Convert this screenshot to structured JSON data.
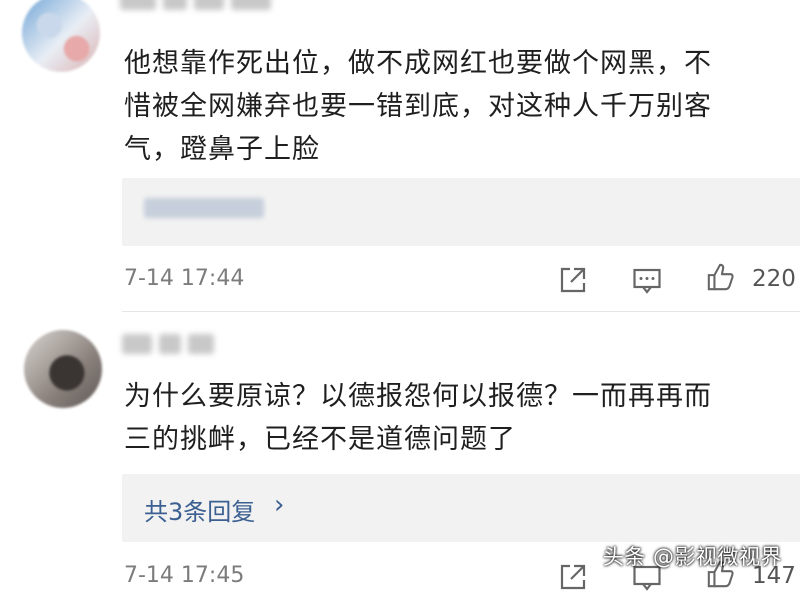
{
  "comments": [
    {
      "text_lines": [
        "他想靠作死出位，做不成网红也要做个网黑，不",
        "惜被全网嫌弃也要一错到底，对这种人千万别客",
        "气，蹬鼻子上脸"
      ],
      "reply_label": "",
      "time": "7-14 17:44",
      "likes": "220"
    },
    {
      "text_lines": [
        "为什么要原谅？以德报怨何以报德？一而再再而",
        "三的挑衅，已经不是道德问题了"
      ],
      "reply_label": "共3条回复",
      "reply_chevron": "›",
      "time": "7-14 17:45",
      "likes": "147"
    }
  ],
  "watermark": "头条 @影视微视界"
}
